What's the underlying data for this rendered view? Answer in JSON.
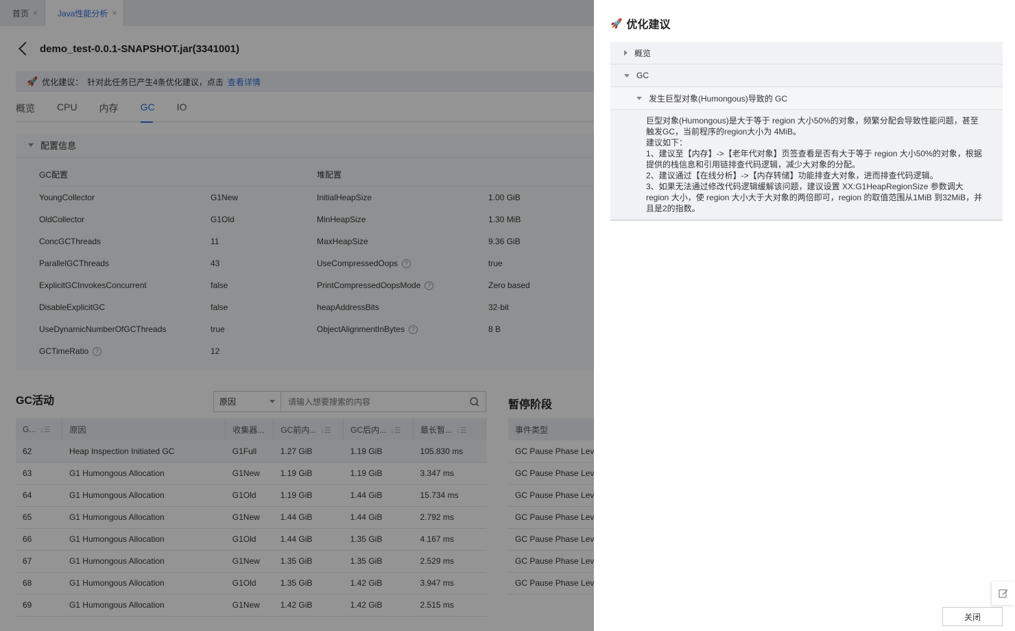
{
  "tabs": [
    {
      "label": "首页",
      "close": "×"
    },
    {
      "label": "Java性能分析",
      "close": "×"
    }
  ],
  "header": {
    "title": "demo_test-0.0.1-SNAPSHOT.jar(3341001)"
  },
  "notice": {
    "prefix": "优化建议：",
    "text": "针对此任务已产生4条优化建议，点击",
    "link": "查看详情"
  },
  "subtabs": [
    "概览",
    "CPU",
    "内存",
    "GC",
    "IO"
  ],
  "config": {
    "title": "配置信息",
    "gc_heading": "GC配置",
    "heap_heading": "堆配置",
    "gc_rows": [
      {
        "k": "YoungCollector",
        "v": "G1New"
      },
      {
        "k": "OldCollector",
        "v": "G1Old"
      },
      {
        "k": "ConcGCThreads",
        "v": "11"
      },
      {
        "k": "ParallelGCThreads",
        "v": "43"
      },
      {
        "k": "ExplicitGCInvokesConcurrent",
        "v": "false"
      },
      {
        "k": "DisableExplicitGC",
        "v": "false"
      },
      {
        "k": "UseDynamicNumberOfGCThreads",
        "v": "true"
      },
      {
        "k": "GCTimeRatio",
        "v": "12",
        "help": true
      }
    ],
    "heap_rows": [
      {
        "k": "InitialHeapSize",
        "v": "1.00 GiB"
      },
      {
        "k": "MinHeapSize",
        "v": "1.30 MiB"
      },
      {
        "k": "MaxHeapSize",
        "v": "9.36 GiB"
      },
      {
        "k": "UseCompressedOops",
        "v": "true",
        "help": true
      },
      {
        "k": "PrintCompressedOopsMode",
        "v": "Zero based",
        "help": true
      },
      {
        "k": "heapAddressBits",
        "v": "32-bit"
      },
      {
        "k": "ObjectAlignmentInBytes",
        "v": "8 B",
        "help": true
      }
    ]
  },
  "gc_activity": {
    "title": "GC活动",
    "search_select": "原因",
    "search_placeholder": "请输入想要搜索的内容",
    "columns": [
      "G...",
      "原因",
      "收集器...",
      "GC前内...",
      "GC后内...",
      "最长暂..."
    ],
    "rows": [
      [
        "62",
        "Heap Inspection Initiated GC",
        "G1Full",
        "1.27 GiB",
        "1.19 GiB",
        "105.830 ms"
      ],
      [
        "63",
        "G1 Humongous Allocation",
        "G1New",
        "1.19 GiB",
        "1.19 GiB",
        "3.347 ms"
      ],
      [
        "64",
        "G1 Humongous Allocation",
        "G1Old",
        "1.19 GiB",
        "1.44 GiB",
        "15.734 ms"
      ],
      [
        "65",
        "G1 Humongous Allocation",
        "G1New",
        "1.44 GiB",
        "1.44 GiB",
        "2.792 ms"
      ],
      [
        "66",
        "G1 Humongous Allocation",
        "G1Old",
        "1.44 GiB",
        "1.35 GiB",
        "4.167 ms"
      ],
      [
        "67",
        "G1 Humongous Allocation",
        "G1New",
        "1.35 GiB",
        "1.35 GiB",
        "2.529 ms"
      ],
      [
        "68",
        "G1 Humongous Allocation",
        "G1Old",
        "1.35 GiB",
        "1.42 GiB",
        "3.947 ms"
      ],
      [
        "69",
        "G1 Humongous Allocation",
        "G1New",
        "1.42 GiB",
        "1.42 GiB",
        "2.515 ms"
      ]
    ]
  },
  "pause_phase": {
    "title": "暂停阶段",
    "column": "事件类型",
    "rows": [
      "GC Pause Phase Level",
      "GC Pause Phase Level",
      "GC Pause Phase Level",
      "GC Pause Phase Level",
      "GC Pause Phase Level",
      "GC Pause Phase Level",
      "GC Pause Phase Level"
    ]
  },
  "drawer": {
    "title": "优化建议",
    "overview_label": "概览",
    "gc_label": "GC",
    "item_label": "发生巨型对象(Humongous)导致的 GC",
    "body": [
      "巨型对象(Humongous)是大于等于 region 大小50%的对象，频繁分配会导致性能问题，甚至触发GC，当前程序的region大小为 4MiB。",
      "建议如下：",
      "1、建议至【内存】->【老年代对象】页签查看是否有大于等于 region 大小50%的对象，根据提供的栈信息和引用链排查代码逻辑，减少大对象的分配。",
      "2、建议通过【在线分析】->【内存转储】功能排查大对象，进而排查代码逻辑。",
      "3、如果无法通过修改代码逻辑缓解该问题，建议设置 XX:G1HeapRegionSize 参数调大 region 大小，使 region 大小大于大对象的两倍即可，region 的取值范围从1MiB 到32MiB，并且是2的指数。"
    ],
    "close_label": "关闭"
  },
  "icons": {
    "rocket": "rocket-icon",
    "accent": "#2b6fe0"
  }
}
